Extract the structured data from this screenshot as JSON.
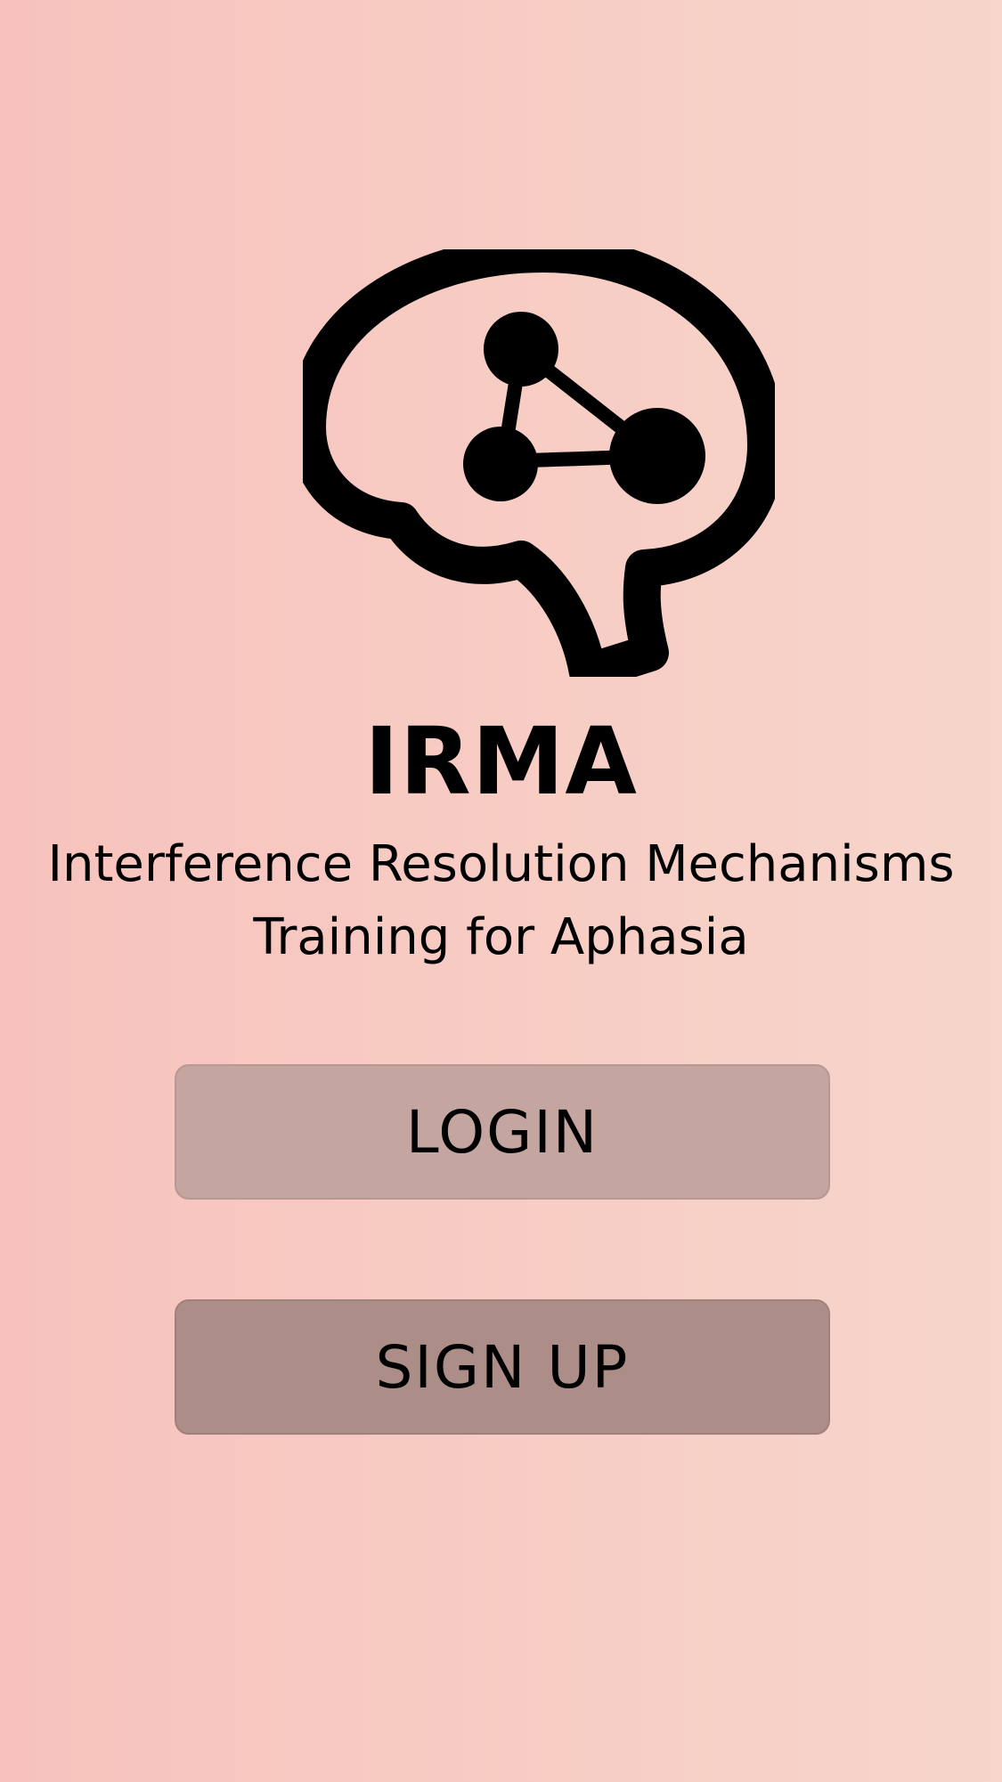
{
  "app": {
    "name": "IRMA",
    "subtitle_line1": "Interference Resolution Mechanisms",
    "subtitle_line2": "Training for Aphasia",
    "logo_icon": "brain-network-icon"
  },
  "actions": {
    "login_label": "LOGIN",
    "signup_label": "SIGN UP"
  },
  "colors": {
    "background_left": "#f7c2bd",
    "background_right": "#f7d5cb",
    "login_button": "#c5a59f",
    "signup_button": "#ad8d87",
    "text": "#000000"
  }
}
